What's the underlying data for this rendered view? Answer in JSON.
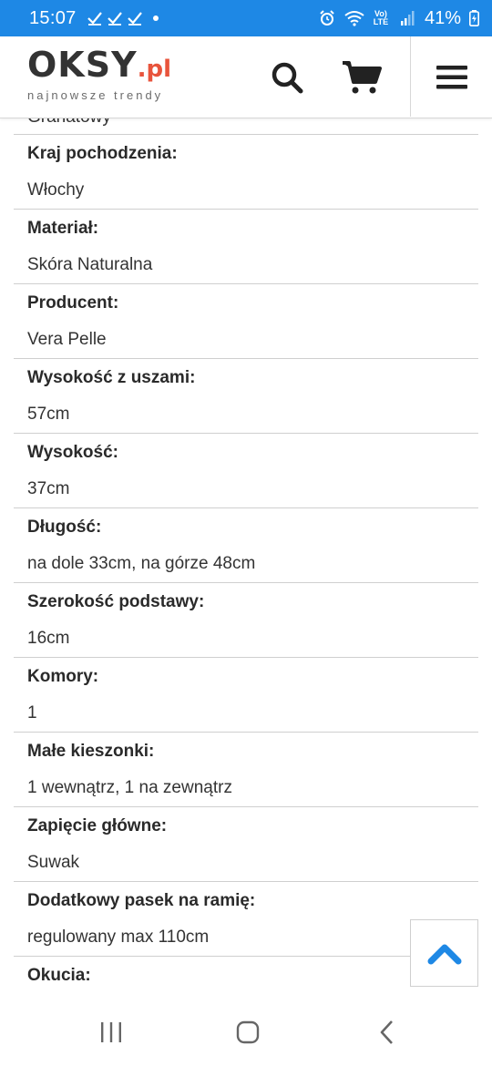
{
  "status_bar": {
    "time": "15:07",
    "battery": "41%",
    "network_label": "Vo) LTE"
  },
  "header": {
    "logo_main": "OKSY",
    "logo_suffix": ".pl",
    "logo_tagline": "najnowsze trendy",
    "icons": [
      "search-icon",
      "cart-icon",
      "menu-icon"
    ]
  },
  "specs": {
    "partial_value": "Granatowy",
    "rows": [
      {
        "label": "Kraj pochodzenia:",
        "value": "Włochy"
      },
      {
        "label": "Materiał:",
        "value": "Skóra Naturalna"
      },
      {
        "label": "Producent:",
        "value": "Vera Pelle"
      },
      {
        "label": "Wysokość z uszami:",
        "value": "57cm"
      },
      {
        "label": "Wysokość:",
        "value": "37cm"
      },
      {
        "label": "Długość:",
        "value": "na dole 33cm, na górze 48cm"
      },
      {
        "label": "Szerokość podstawy:",
        "value": "16cm"
      },
      {
        "label": "Komory:",
        "value": "1"
      },
      {
        "label": "Małe kieszonki:",
        "value": "1 wewnątrz, 1 na zewnątrz"
      },
      {
        "label": "Zapięcie główne:",
        "value": "Suwak"
      },
      {
        "label": "Dodatkowy pasek na ramię:",
        "value": "regulowany max 110cm"
      },
      {
        "label": "Okucia:",
        "value": ""
      }
    ]
  },
  "colors": {
    "status_bar": "#1e88e5",
    "accent": "#e8543c",
    "scroll_top_arrow": "#1e88e5"
  }
}
